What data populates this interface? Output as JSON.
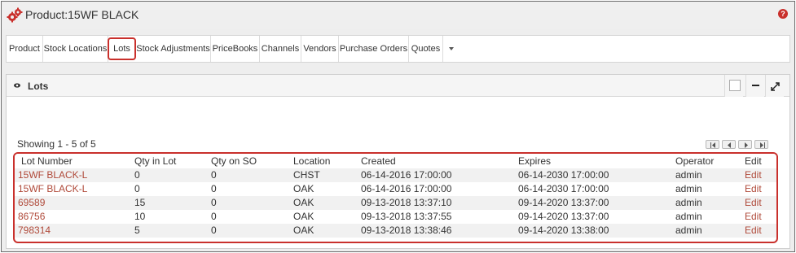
{
  "header": {
    "title": "Product:15WF BLACK",
    "help_symbol": "?",
    "accent_color": "#c9302c"
  },
  "tabs": [
    {
      "label": "Product",
      "active": false
    },
    {
      "label": "Stock Locations",
      "active": false
    },
    {
      "label": "Lots",
      "active": true
    },
    {
      "label": "Stock Adjustments",
      "active": false
    },
    {
      "label": "PriceBooks",
      "active": false
    },
    {
      "label": "Channels",
      "active": false
    },
    {
      "label": "Vendors",
      "active": false
    },
    {
      "label": "Purchase Orders",
      "active": false
    },
    {
      "label": "Quotes",
      "active": false
    }
  ],
  "panel": {
    "title": "Lots",
    "showing": "Showing 1 - 5 of 5",
    "columns": [
      "Lot Number",
      "Qty in Lot",
      "Qty on SO",
      "Location",
      "Created",
      "Expires",
      "Operator",
      "Edit"
    ],
    "rows": [
      {
        "lot": "15WF BLACK-L",
        "qty_lot": "0",
        "qty_so": "0",
        "location": "CHST",
        "created": "06-14-2016 17:00:00",
        "expires": "06-14-2030 17:00:00",
        "operator": "admin",
        "edit": "Edit"
      },
      {
        "lot": "15WF BLACK-L",
        "qty_lot": "0",
        "qty_so": "0",
        "location": "OAK",
        "created": "06-14-2016 17:00:00",
        "expires": "06-14-2030 17:00:00",
        "operator": "admin",
        "edit": "Edit"
      },
      {
        "lot": "69589",
        "qty_lot": "15",
        "qty_so": "0",
        "location": "OAK",
        "created": "09-13-2018 13:37:10",
        "expires": "09-14-2020 13:37:00",
        "operator": "admin",
        "edit": "Edit"
      },
      {
        "lot": "86756",
        "qty_lot": "10",
        "qty_so": "0",
        "location": "OAK",
        "created": "09-13-2018 13:37:55",
        "expires": "09-14-2020 13:37:00",
        "operator": "admin",
        "edit": "Edit"
      },
      {
        "lot": "798314",
        "qty_lot": "5",
        "qty_so": "0",
        "location": "OAK",
        "created": "09-13-2018 13:38:46",
        "expires": "09-14-2020 13:38:00",
        "operator": "admin",
        "edit": "Edit"
      }
    ]
  }
}
